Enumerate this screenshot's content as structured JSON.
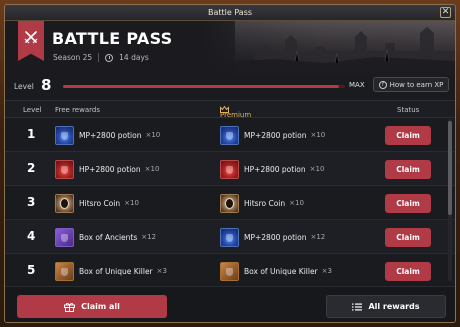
{
  "window": {
    "title": "Battle Pass",
    "close_glyph": "✕"
  },
  "hero": {
    "title": "BATTLE PASS",
    "season": "Season 25",
    "duration": "14 days"
  },
  "level": {
    "label": "Level",
    "value": "8",
    "progress_fraction": 0.98,
    "max_label": "MAX",
    "how_to_label": "How to earn XP",
    "help_icon": "?"
  },
  "columns": {
    "level": "Level",
    "free": "Free rewards",
    "premium": "Premium rewards",
    "status": "Status"
  },
  "rows": [
    {
      "level": "1",
      "free": {
        "icon": "mp-potion-icon",
        "name": "MP+2800 potion",
        "qty": "×10"
      },
      "premium": {
        "icon": "mp-potion-icon",
        "name": "MP+2800 potion",
        "qty": "×10"
      },
      "status": "Claim"
    },
    {
      "level": "2",
      "free": {
        "icon": "hp-potion-icon",
        "name": "HP+2800 potion",
        "qty": "×10"
      },
      "premium": {
        "icon": "hp-potion-icon",
        "name": "HP+2800 potion",
        "qty": "×10"
      },
      "status": "Claim"
    },
    {
      "level": "3",
      "free": {
        "icon": "hitsro-coin-icon",
        "name": "Hitsro Coin",
        "qty": "×10"
      },
      "premium": {
        "icon": "hitsro-coin-icon",
        "name": "Hitsro Coin",
        "qty": "×10"
      },
      "status": "Claim"
    },
    {
      "level": "4",
      "free": {
        "icon": "box-of-ancients-icon",
        "name": "Box of Ancients",
        "qty": "×12"
      },
      "premium": {
        "icon": "mp-potion-icon",
        "name": "MP+2800 potion",
        "qty": "×12"
      },
      "status": "Claim"
    },
    {
      "level": "5",
      "free": {
        "icon": "box-of-unique-killer-icon",
        "name": "Box of Unique Killer",
        "qty": "×3"
      },
      "premium": {
        "icon": "box-of-unique-killer-icon",
        "name": "Box of Unique Killer",
        "qty": "×3"
      },
      "status": "Claim"
    }
  ],
  "footer": {
    "claim_all": "Claim all",
    "all_rewards": "All rewards"
  },
  "colors": {
    "accent": "#b03a46",
    "premium": "#e0b060",
    "background": "#1a1b1f"
  }
}
